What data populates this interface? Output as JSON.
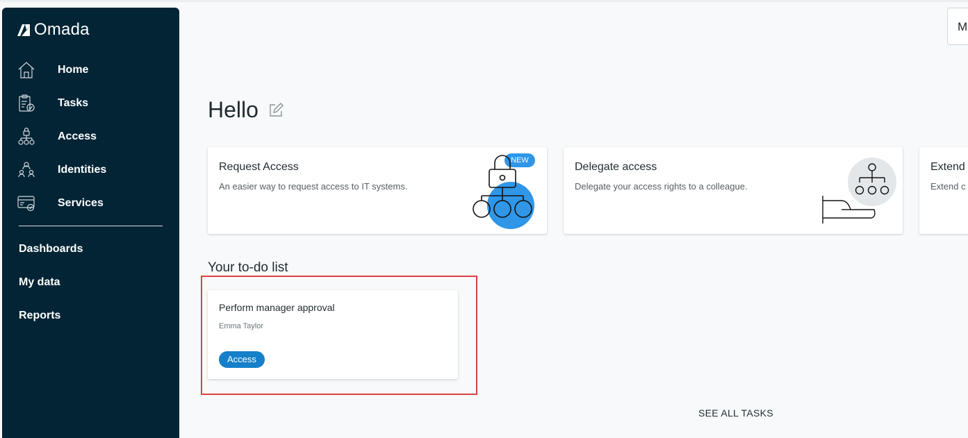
{
  "app": {
    "brand": "Omada"
  },
  "sidebar": {
    "items": [
      {
        "label": "Home",
        "icon": "home-icon"
      },
      {
        "label": "Tasks",
        "icon": "tasks-clipboard-icon"
      },
      {
        "label": "Access",
        "icon": "access-lock-tree-icon"
      },
      {
        "label": "Identities",
        "icon": "identities-people-icon"
      },
      {
        "label": "Services",
        "icon": "services-card-icon"
      }
    ],
    "links": [
      {
        "label": "Dashboards"
      },
      {
        "label": "My data"
      },
      {
        "label": "Reports"
      }
    ]
  },
  "header": {
    "user_button_text": "M"
  },
  "main": {
    "greeting": "Hello",
    "cards": [
      {
        "title": "Request Access",
        "description": "An easier way to request access to IT systems.",
        "badge": "NEW"
      },
      {
        "title": "Delegate access",
        "description": "Delegate your access rights to a colleague."
      },
      {
        "title": "Extend",
        "description": "Extend c"
      }
    ],
    "todo": {
      "heading": "Your to-do list",
      "tasks": [
        {
          "title": "Perform manager approval",
          "person": "Emma Taylor",
          "tag": "Access"
        }
      ],
      "see_all": "SEE ALL TASKS"
    }
  },
  "colors": {
    "sidebar_bg": "#022435",
    "accent_blue": "#2f96e8",
    "tag_blue": "#1580c9",
    "highlight_red": "#d9413f"
  }
}
